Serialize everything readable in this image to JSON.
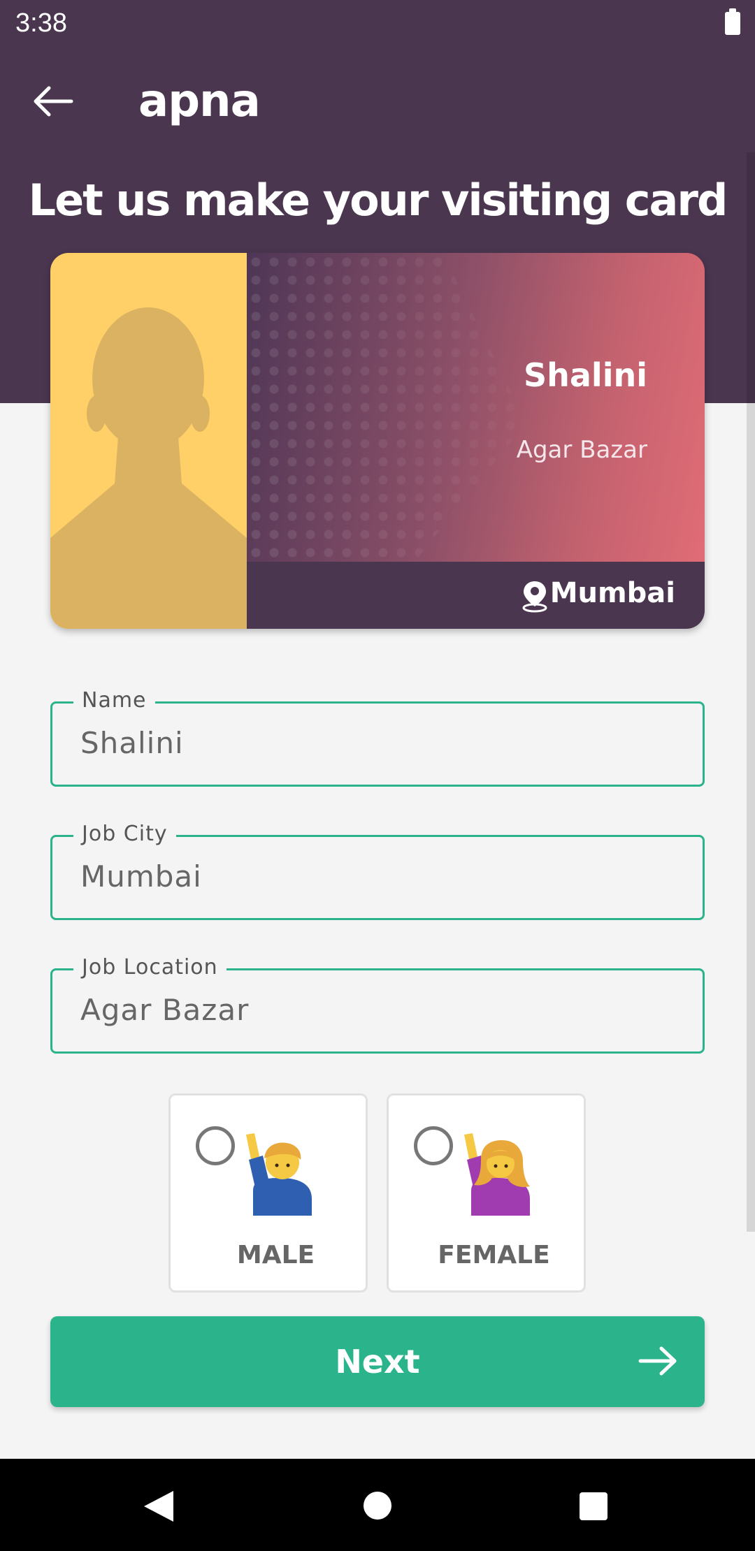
{
  "status_bar": {
    "time": "3:38",
    "battery_icon": "battery-full-icon"
  },
  "app_bar": {
    "back_icon": "arrow-left-icon",
    "title": "apna"
  },
  "heading": "Let us make your visiting card",
  "card_preview": {
    "name": "Shalini",
    "location": "Agar Bazar",
    "city": "Mumbai",
    "photo_icon": "person-silhouette-icon",
    "pin_icon": "location-pin-icon"
  },
  "form": {
    "name": {
      "label": "Name",
      "value": "Shalini"
    },
    "job_city": {
      "label": "Job City",
      "value": "Mumbai"
    },
    "job_location": {
      "label": "Job Location",
      "value": "Agar Bazar"
    }
  },
  "gender": {
    "male": {
      "label": "MALE",
      "selected": false,
      "icon": "man-raising-hand-icon"
    },
    "female": {
      "label": "FEMALE",
      "selected": false,
      "icon": "woman-raising-hand-icon"
    }
  },
  "next_button": {
    "label": "Next",
    "icon": "arrow-right-icon"
  },
  "colors": {
    "header": "#4b3650",
    "accent": "#2bb48c",
    "photo_bg": "#fed067",
    "background": "#f4f4f4"
  }
}
